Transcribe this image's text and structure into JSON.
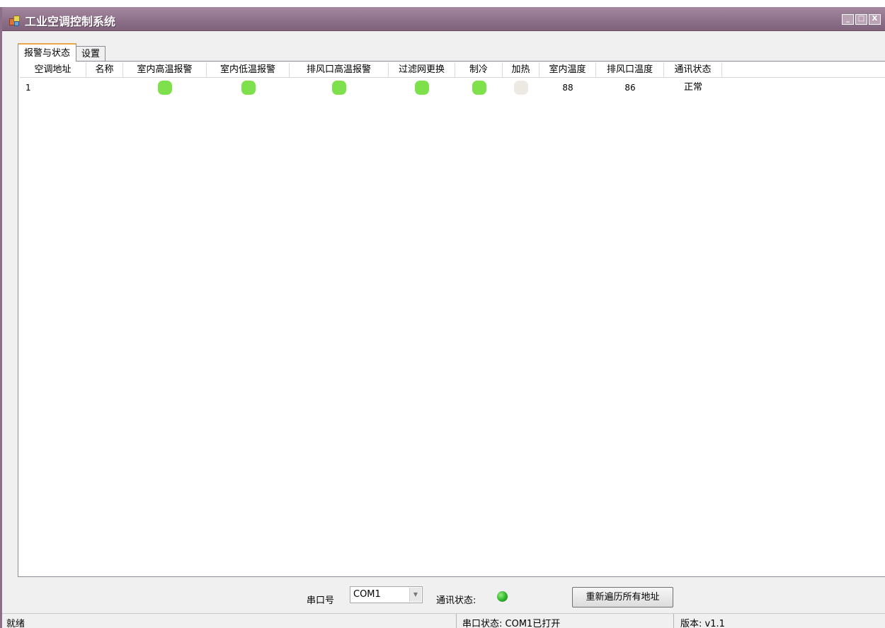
{
  "window": {
    "title": "工业空调控制系统",
    "controls": {
      "minimize": "_",
      "maximize": "□",
      "close": "X"
    }
  },
  "tabs": [
    {
      "label": "报警与状态",
      "active": true
    },
    {
      "label": "设置",
      "active": false
    }
  ],
  "table": {
    "columns": [
      "空调地址",
      "名称",
      "室内高温报警",
      "室内低温报警",
      "排风口高温报警",
      "过滤网更换",
      "制冷",
      "加热",
      "室内温度",
      "排风口温度",
      "通讯状态"
    ],
    "rows": [
      {
        "address": "1",
        "name": "",
        "indoor_high_temp_alarm": "green",
        "indoor_low_temp_alarm": "green",
        "exhaust_high_temp_alarm": "green",
        "filter_replace": "green",
        "cooling": "green",
        "heating": "off",
        "indoor_temp": "88",
        "exhaust_temp": "86",
        "comm_status": "正常"
      }
    ]
  },
  "controls": {
    "port_label": "串口号",
    "port_value": "COM1",
    "comm_label": "通讯状态:",
    "comm_led": "green",
    "rescan_label": "重新遍历所有地址"
  },
  "statusbar": {
    "ready": "就绪",
    "port_status": "串口状态: COM1已打开",
    "version": "版本: v1.1"
  },
  "colors": {
    "titlebar": "#8d6f89",
    "led_on": "#7ee04a",
    "led_off": "#ece9e3",
    "tab_accent": "#e8a84a"
  }
}
